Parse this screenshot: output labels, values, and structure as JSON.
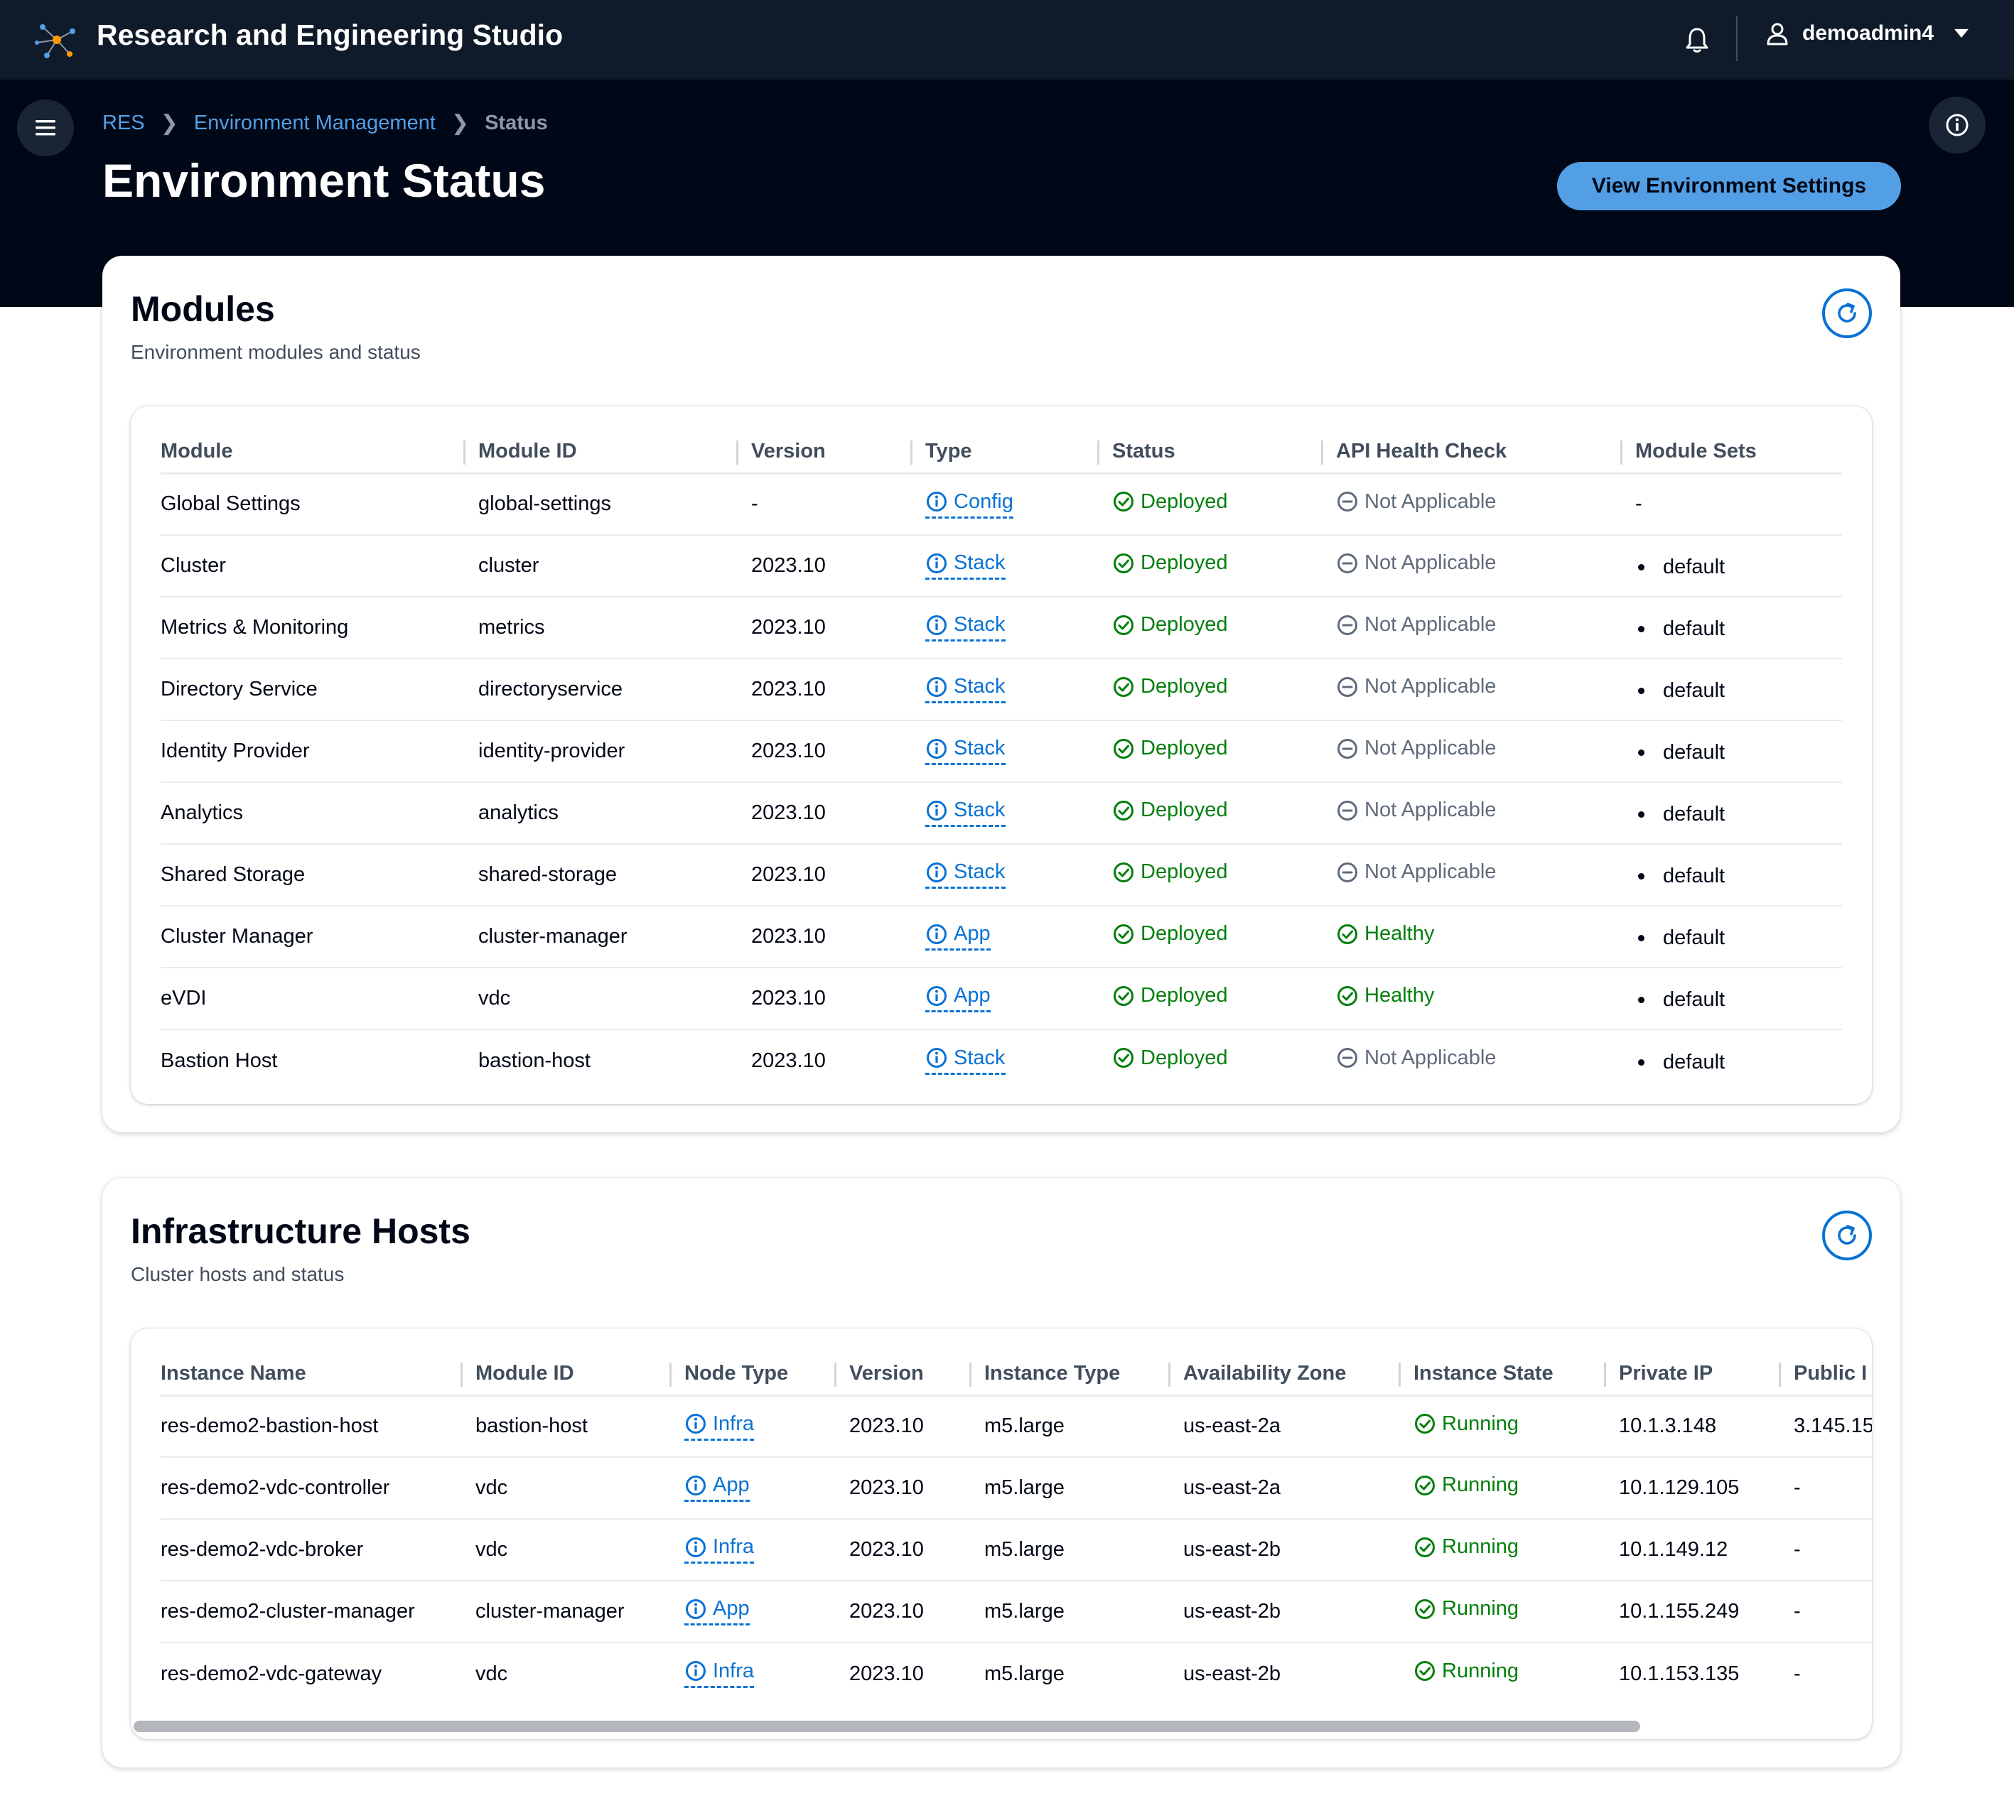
{
  "header": {
    "app_title": "Research and Engineering Studio",
    "username": "demoadmin4",
    "logo_icon": "network-nodes-icon",
    "notification_icon": "bell-icon",
    "user_icon": "user-icon"
  },
  "breadcrumb": [
    "RES",
    "Environment Management",
    "Status"
  ],
  "page": {
    "title": "Environment Status",
    "primary_button": "View Environment Settings"
  },
  "modules": {
    "title": "Modules",
    "description": "Environment modules and status",
    "columns": [
      "Module",
      "Module ID",
      "Version",
      "Type",
      "Status",
      "API Health Check",
      "Module Sets"
    ],
    "rows": [
      {
        "module": "Global Settings",
        "module_id": "global-settings",
        "version": "-",
        "type": "Config",
        "status": "Deployed",
        "health": "Not Applicable",
        "health_ok": false,
        "sets": "-",
        "sets_bullet": false
      },
      {
        "module": "Cluster",
        "module_id": "cluster",
        "version": "2023.10",
        "type": "Stack",
        "status": "Deployed",
        "health": "Not Applicable",
        "health_ok": false,
        "sets": "default",
        "sets_bullet": true
      },
      {
        "module": "Metrics & Monitoring",
        "module_id": "metrics",
        "version": "2023.10",
        "type": "Stack",
        "status": "Deployed",
        "health": "Not Applicable",
        "health_ok": false,
        "sets": "default",
        "sets_bullet": true
      },
      {
        "module": "Directory Service",
        "module_id": "directoryservice",
        "version": "2023.10",
        "type": "Stack",
        "status": "Deployed",
        "health": "Not Applicable",
        "health_ok": false,
        "sets": "default",
        "sets_bullet": true
      },
      {
        "module": "Identity Provider",
        "module_id": "identity-provider",
        "version": "2023.10",
        "type": "Stack",
        "status": "Deployed",
        "health": "Not Applicable",
        "health_ok": false,
        "sets": "default",
        "sets_bullet": true
      },
      {
        "module": "Analytics",
        "module_id": "analytics",
        "version": "2023.10",
        "type": "Stack",
        "status": "Deployed",
        "health": "Not Applicable",
        "health_ok": false,
        "sets": "default",
        "sets_bullet": true
      },
      {
        "module": "Shared Storage",
        "module_id": "shared-storage",
        "version": "2023.10",
        "type": "Stack",
        "status": "Deployed",
        "health": "Not Applicable",
        "health_ok": false,
        "sets": "default",
        "sets_bullet": true
      },
      {
        "module": "Cluster Manager",
        "module_id": "cluster-manager",
        "version": "2023.10",
        "type": "App",
        "status": "Deployed",
        "health": "Healthy",
        "health_ok": true,
        "sets": "default",
        "sets_bullet": true
      },
      {
        "module": "eVDI",
        "module_id": "vdc",
        "version": "2023.10",
        "type": "App",
        "status": "Deployed",
        "health": "Healthy",
        "health_ok": true,
        "sets": "default",
        "sets_bullet": true
      },
      {
        "module": "Bastion Host",
        "module_id": "bastion-host",
        "version": "2023.10",
        "type": "Stack",
        "status": "Deployed",
        "health": "Not Applicable",
        "health_ok": false,
        "sets": "default",
        "sets_bullet": true
      }
    ]
  },
  "hosts": {
    "title": "Infrastructure Hosts",
    "description": "Cluster hosts and status",
    "columns": [
      "Instance Name",
      "Module ID",
      "Node Type",
      "Version",
      "Instance Type",
      "Availability Zone",
      "Instance State",
      "Private IP",
      "Public I"
    ],
    "rows": [
      {
        "name": "res-demo2-bastion-host",
        "module_id": "bastion-host",
        "node_type": "Infra",
        "version": "2023.10",
        "instance_type": "m5.large",
        "az": "us-east-2a",
        "state": "Running",
        "private_ip": "10.1.3.148",
        "public_ip": "3.145.15"
      },
      {
        "name": "res-demo2-vdc-controller",
        "module_id": "vdc",
        "node_type": "App",
        "version": "2023.10",
        "instance_type": "m5.large",
        "az": "us-east-2a",
        "state": "Running",
        "private_ip": "10.1.129.105",
        "public_ip": "-"
      },
      {
        "name": "res-demo2-vdc-broker",
        "module_id": "vdc",
        "node_type": "Infra",
        "version": "2023.10",
        "instance_type": "m5.large",
        "az": "us-east-2b",
        "state": "Running",
        "private_ip": "10.1.149.12",
        "public_ip": "-"
      },
      {
        "name": "res-demo2-cluster-manager",
        "module_id": "cluster-manager",
        "node_type": "App",
        "version": "2023.10",
        "instance_type": "m5.large",
        "az": "us-east-2b",
        "state": "Running",
        "private_ip": "10.1.155.249",
        "public_ip": "-"
      },
      {
        "name": "res-demo2-vdc-gateway",
        "module_id": "vdc",
        "node_type": "Infra",
        "version": "2023.10",
        "instance_type": "m5.large",
        "az": "us-east-2b",
        "state": "Running",
        "private_ip": "10.1.153.135",
        "public_ip": "-"
      }
    ]
  },
  "colors": {
    "header_bg": "#0f1b2a",
    "hero_bg": "#000716",
    "link": "#0972d3",
    "success": "#037f0c",
    "muted": "#5f6b7a",
    "primary_button": "#539fe5"
  }
}
